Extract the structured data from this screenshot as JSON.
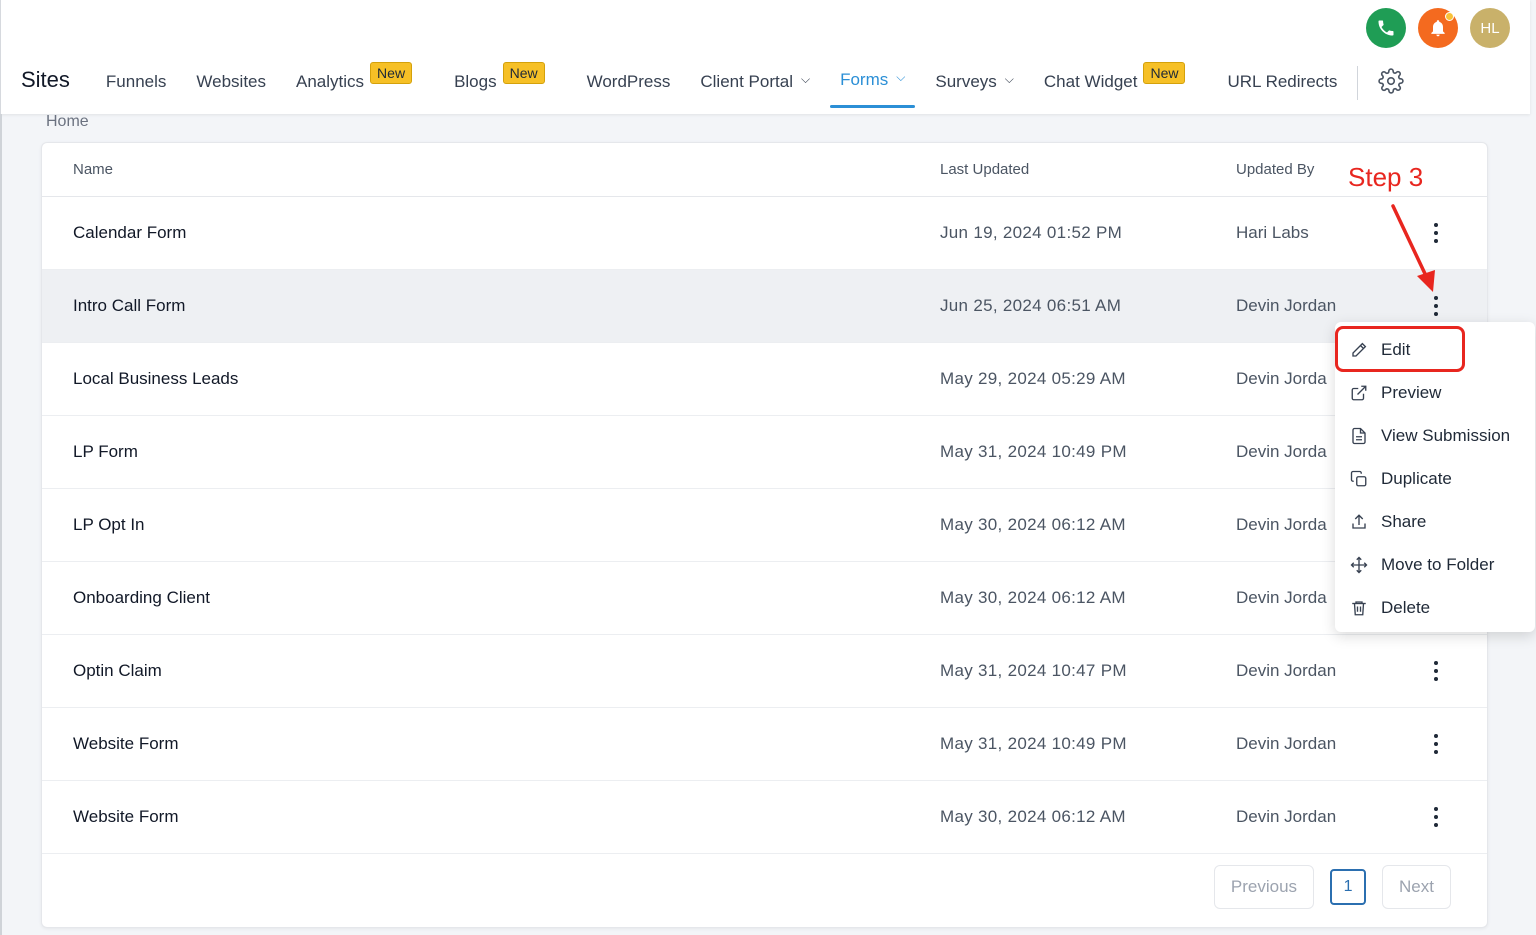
{
  "header": {
    "avatar_initials": "HL",
    "title": "Sites",
    "nav": [
      {
        "label": "Funnels"
      },
      {
        "label": "Websites"
      },
      {
        "label": "Analytics",
        "badge": "New"
      },
      {
        "label": "Blogs",
        "badge": "New"
      },
      {
        "label": "WordPress"
      },
      {
        "label": "Client Portal",
        "dropdown": true
      },
      {
        "label": "Forms",
        "dropdown": true,
        "active": true
      },
      {
        "label": "Surveys",
        "dropdown": true
      },
      {
        "label": "Chat Widget",
        "badge": "New"
      },
      {
        "label": "URL Redirects"
      }
    ]
  },
  "breadcrumb": "Home",
  "table": {
    "columns": {
      "name": "Name",
      "last_updated": "Last Updated",
      "updated_by": "Updated By"
    },
    "rows": [
      {
        "name": "Calendar Form",
        "date": "Jun 19, 2024 01:52 PM",
        "by": "Hari Labs"
      },
      {
        "name": "Intro Call Form",
        "date": "Jun 25, 2024 06:51 AM",
        "by": "Devin Jordan"
      },
      {
        "name": "Local Business Leads",
        "date": "May 29, 2024 05:29 AM",
        "by": "Devin Jorda"
      },
      {
        "name": "LP Form",
        "date": "May 31, 2024 10:49 PM",
        "by": "Devin Jorda"
      },
      {
        "name": "LP Opt In",
        "date": "May 30, 2024 06:12 AM",
        "by": "Devin Jorda"
      },
      {
        "name": "Onboarding Client",
        "date": "May 30, 2024 06:12 AM",
        "by": "Devin Jorda"
      },
      {
        "name": "Optin Claim",
        "date": "May 31, 2024 10:47 PM",
        "by": "Devin Jordan"
      },
      {
        "name": "Website Form",
        "date": "May 31, 2024 10:49 PM",
        "by": "Devin Jordan"
      },
      {
        "name": "Website Form",
        "date": "May 30, 2024 06:12 AM",
        "by": "Devin Jordan"
      }
    ]
  },
  "pagination": {
    "previous": "Previous",
    "page": "1",
    "next": "Next"
  },
  "menu": {
    "items": [
      {
        "label": "Edit",
        "icon": "pencil-icon"
      },
      {
        "label": "Preview",
        "icon": "external-link-icon"
      },
      {
        "label": "View Submission",
        "icon": "document-icon"
      },
      {
        "label": "Duplicate",
        "icon": "copy-icon"
      },
      {
        "label": "Share",
        "icon": "share-icon"
      },
      {
        "label": "Move to Folder",
        "icon": "move-icon"
      },
      {
        "label": "Delete",
        "icon": "trash-icon"
      }
    ]
  },
  "annotation": {
    "step_label": "Step 3",
    "color": "#e8261f"
  },
  "colors": {
    "accent": "#2b8fd6",
    "badge": "#f6c026",
    "phone": "#1f9d55",
    "bell": "#f46a1f"
  }
}
